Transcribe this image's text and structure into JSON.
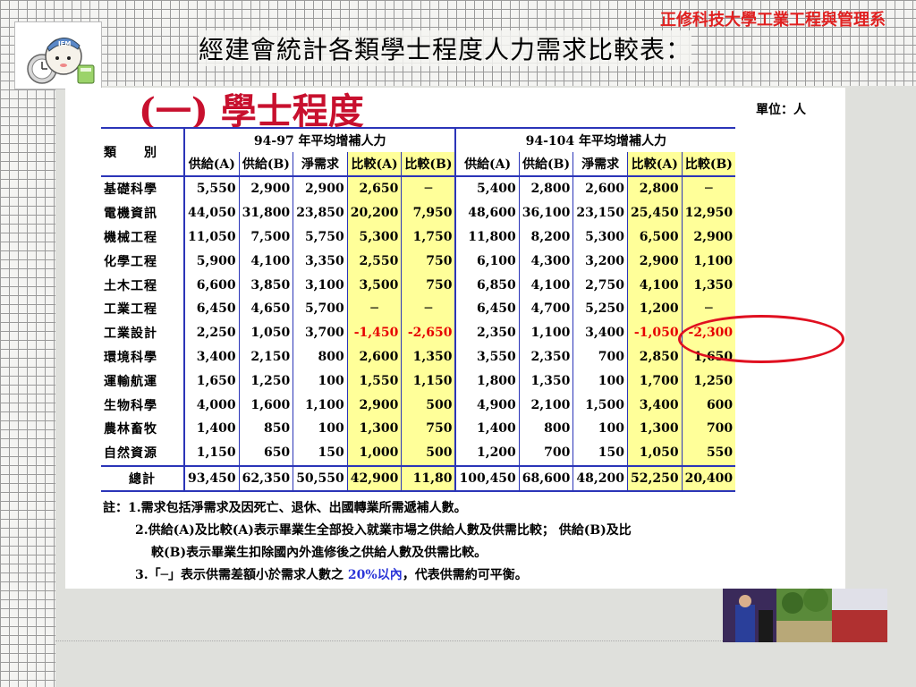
{
  "header": {
    "title": "經建會統計各類學士程度人力需求比較表：",
    "dept": "正修科技大學工業工程與管理系",
    "logo_text": "IEM"
  },
  "panel": {
    "section_title": "(一) 學士程度",
    "unit": "單位：人"
  },
  "table": {
    "category_header": "類　　別",
    "group1": "94-97 年平均增補人力",
    "group2": "94-104 年平均增補人力",
    "subheaders": [
      "供給(A)",
      "供給(B)",
      "淨需求",
      "比較(A)",
      "比較(B)",
      "供給(A)",
      "供給(B)",
      "淨需求",
      "比較(A)",
      "比較(B)"
    ],
    "rows": [
      {
        "cat": "基礎科學",
        "v": [
          "5,550",
          "2,900",
          "2,900",
          "2,650",
          "─",
          "5,400",
          "2,800",
          "2,600",
          "2,800",
          "─"
        ]
      },
      {
        "cat": "電機資訊",
        "v": [
          "44,050",
          "31,800",
          "23,850",
          "20,200",
          "7,950",
          "48,600",
          "36,100",
          "23,150",
          "25,450",
          "12,950"
        ]
      },
      {
        "cat": "機械工程",
        "v": [
          "11,050",
          "7,500",
          "5,750",
          "5,300",
          "1,750",
          "11,800",
          "8,200",
          "5,300",
          "6,500",
          "2,900"
        ]
      },
      {
        "cat": "化學工程",
        "v": [
          "5,900",
          "4,100",
          "3,350",
          "2,550",
          "750",
          "6,100",
          "4,300",
          "3,200",
          "2,900",
          "1,100"
        ]
      },
      {
        "cat": "土木工程",
        "v": [
          "6,600",
          "3,850",
          "3,100",
          "3,500",
          "750",
          "6,850",
          "4,100",
          "2,750",
          "4,100",
          "1,350"
        ]
      },
      {
        "cat": "工業工程",
        "v": [
          "6,450",
          "4,650",
          "5,700",
          "─",
          "─",
          "6,450",
          "4,700",
          "5,250",
          "1,200",
          "─"
        ]
      },
      {
        "cat": "工業設計",
        "v": [
          "2,250",
          "1,050",
          "3,700",
          "-1,450",
          "-2,650",
          "2,350",
          "1,100",
          "3,400",
          "-1,050",
          "-2,300"
        ]
      },
      {
        "cat": "環境科學",
        "v": [
          "3,400",
          "2,150",
          "800",
          "2,600",
          "1,350",
          "3,550",
          "2,350",
          "700",
          "2,850",
          "1,650"
        ]
      },
      {
        "cat": "運輸航運",
        "v": [
          "1,650",
          "1,250",
          "100",
          "1,550",
          "1,150",
          "1,800",
          "1,350",
          "100",
          "1,700",
          "1,250"
        ]
      },
      {
        "cat": "生物科學",
        "v": [
          "4,000",
          "1,600",
          "1,100",
          "2,900",
          "500",
          "4,900",
          "2,100",
          "1,500",
          "3,400",
          "600"
        ]
      },
      {
        "cat": "農林畜牧",
        "v": [
          "1,400",
          "850",
          "100",
          "1,300",
          "750",
          "1,400",
          "800",
          "100",
          "1,300",
          "700"
        ]
      },
      {
        "cat": "自然資源",
        "v": [
          "1,150",
          "650",
          "150",
          "1,000",
          "500",
          "1,200",
          "700",
          "150",
          "1,050",
          "550"
        ]
      }
    ],
    "total": {
      "cat": "總計",
      "v": [
        "93,450",
        "62,350",
        "50,550",
        "42,900",
        "11,80",
        "100,450",
        "68,600",
        "48,200",
        "52,250",
        "20,400"
      ]
    }
  },
  "notes": {
    "n1": "註：1.需求包括淨需求及因死亡、退休、出國轉業所需遞補人數。",
    "n2a": "2.供給(A)及比較(A)表示畢業生全部投入就業市場之供給人數及供需比較； 供給(B)及比",
    "n2b": "較(B)表示畢業生扣除國內外進修後之供給人數及供需比較。",
    "n3_pre": "3.「─」表示供需差額小於需求人數之",
    "n3_blue": " 20%以內",
    "n3_post": "，代表供需約可平衡。"
  },
  "colors": {
    "highlight": "#ffff99",
    "negative": "#e60000",
    "rule": "#2b35b8",
    "section_title": "#c8102e",
    "dept": "#e02020"
  }
}
